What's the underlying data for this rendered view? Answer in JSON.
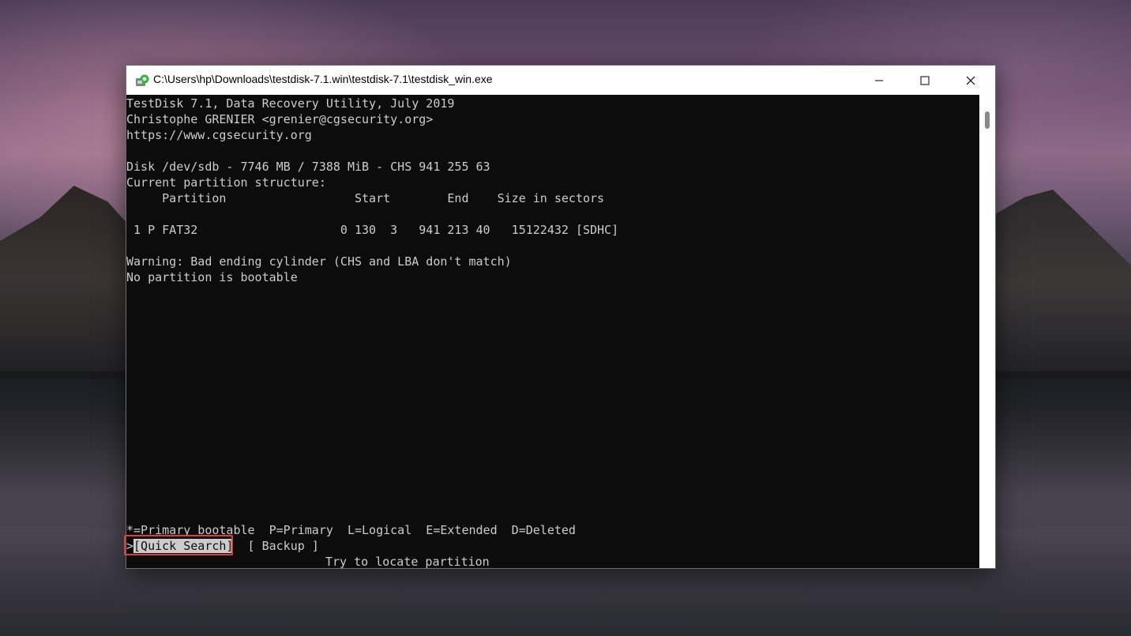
{
  "window": {
    "title": "C:\\Users\\hp\\Downloads\\testdisk-7.1.win\\testdisk-7.1\\testdisk_win.exe"
  },
  "console": {
    "header_line1": "TestDisk 7.1, Data Recovery Utility, July 2019",
    "header_line2": "Christophe GRENIER <grenier@cgsecurity.org>",
    "header_line3": "https://www.cgsecurity.org",
    "disk_info": "Disk /dev/sdb - 7746 MB / 7388 MiB - CHS 941 255 63",
    "structure_title": "Current partition structure:",
    "table_header": "     Partition                  Start        End    Size in sectors",
    "partition_row": " 1 P FAT32                    0 130  3   941 213 40   15122432 [SDHC]",
    "warning": "Warning: Bad ending cylinder (CHS and LBA don't match)",
    "bootable_note": "No partition is bootable",
    "legend": "*=Primary bootable  P=Primary  L=Logical  E=Extended  D=Deleted",
    "menu": {
      "selected_prefix": ">",
      "quick_search": "[Quick Search]",
      "backup": "[ Backup ]",
      "hint": "Try to locate partition"
    }
  },
  "colors": {
    "console_bg": "#0c0c0c",
    "console_fg": "#cccccc",
    "highlight_box": "#e03c3c"
  }
}
